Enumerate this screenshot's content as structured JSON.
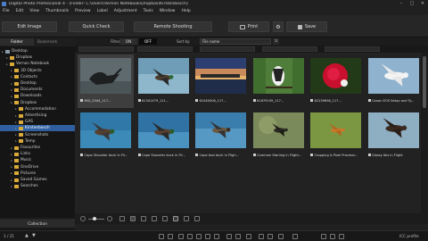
{
  "window": {
    "title": "Digital Photo Professional 4 - [Folder: C:\\Users\\Vernon Notebook\\Dropbox\\Kirstenbosch]",
    "minimize": "–",
    "maximize": "□",
    "close": "✕"
  },
  "menu": [
    "File",
    "Edit",
    "View",
    "Thumbnails",
    "Preview",
    "Label",
    "Adjustment",
    "Tools",
    "Window",
    "Help"
  ],
  "toolbar": {
    "edit_image": "Edit Image",
    "quick_check": "Quick Check",
    "remote_shooting": "Remote Shooting",
    "print": "Print",
    "save": "Save"
  },
  "left_panel": {
    "tabs": [
      "Folder",
      "Bookmark"
    ],
    "tree": [
      {
        "label": "Desktop",
        "level": 0,
        "kind": "desktop"
      },
      {
        "label": "Dropbox",
        "level": 1,
        "kind": "folder"
      },
      {
        "label": "Vernon Notebook",
        "level": 1,
        "kind": "folder"
      },
      {
        "label": "3D Objects",
        "level": 2,
        "kind": "folder"
      },
      {
        "label": "Contacts",
        "level": 2,
        "kind": "folder"
      },
      {
        "label": "Desktop",
        "level": 2,
        "kind": "folder"
      },
      {
        "label": "Documents",
        "level": 2,
        "kind": "folder"
      },
      {
        "label": "Downloads",
        "level": 2,
        "kind": "folder"
      },
      {
        "label": "Dropbox",
        "level": 2,
        "kind": "folder"
      },
      {
        "label": "Accommodation",
        "level": 3,
        "kind": "folder"
      },
      {
        "label": "Advertising",
        "level": 3,
        "kind": "folder"
      },
      {
        "label": "GAS",
        "level": 3,
        "kind": "folder"
      },
      {
        "label": "Kirstenbosch",
        "level": 3,
        "kind": "folder",
        "selected": true
      },
      {
        "label": "Screenshots",
        "level": 3,
        "kind": "folder"
      },
      {
        "label": "Temp",
        "level": 3,
        "kind": "folder"
      },
      {
        "label": "Favourites",
        "level": 2,
        "kind": "folder"
      },
      {
        "label": "Links",
        "level": 2,
        "kind": "folder"
      },
      {
        "label": "Music",
        "level": 2,
        "kind": "folder"
      },
      {
        "label": "OneDrive",
        "level": 2,
        "kind": "folder"
      },
      {
        "label": "Pictures",
        "level": 2,
        "kind": "folder"
      },
      {
        "label": "Saved Games",
        "level": 2,
        "kind": "folder"
      },
      {
        "label": "Searches",
        "level": 2,
        "kind": "folder"
      }
    ],
    "collection_title": "Collection",
    "add_collection": "Add collection"
  },
  "filter_bar": {
    "filter_label": "Filter",
    "on": "ON",
    "off": "OFF",
    "sort_label": "Sort by:",
    "sort_value": "File name"
  },
  "thumbnails": [
    {
      "caption": "IMG_0344_117...",
      "selected": true,
      "scene": "swan"
    },
    {
      "caption": "61341479_111...",
      "selected": false,
      "scene": "duck-water"
    },
    {
      "caption": "61040006_117...",
      "selected": false,
      "scene": "sunset"
    },
    {
      "caption": "61879109_117...",
      "selected": false,
      "scene": "kingfisher"
    },
    {
      "caption": "62239698_117...",
      "selected": false,
      "scene": "rose"
    },
    {
      "caption": "Canon EOS Setup and Ty...",
      "selected": false,
      "scene": "egret"
    },
    {
      "caption": "Cape Shoveler duck in Fli...",
      "selected": false,
      "scene": "shoveler1"
    },
    {
      "caption": "Cape Shoveler duck in Fli...",
      "selected": false,
      "scene": "shoveler2"
    },
    {
      "caption": "Cape teal duck in Fligh...",
      "selected": false,
      "scene": "teal"
    },
    {
      "caption": "Common Starling in Flight...",
      "selected": false,
      "scene": "starling"
    },
    {
      "caption": "Cropping & Pixel Processi...",
      "selected": false,
      "scene": "cropping"
    },
    {
      "caption": "Glossy Ibis in Flight",
      "selected": false,
      "scene": "ibis"
    }
  ],
  "status": {
    "count": "1 / 21",
    "profile": "ICC profile"
  },
  "colors": {
    "selection": "#2f5f9f",
    "folder": "#d9a93a",
    "accent_on": "#3a3a3a"
  }
}
